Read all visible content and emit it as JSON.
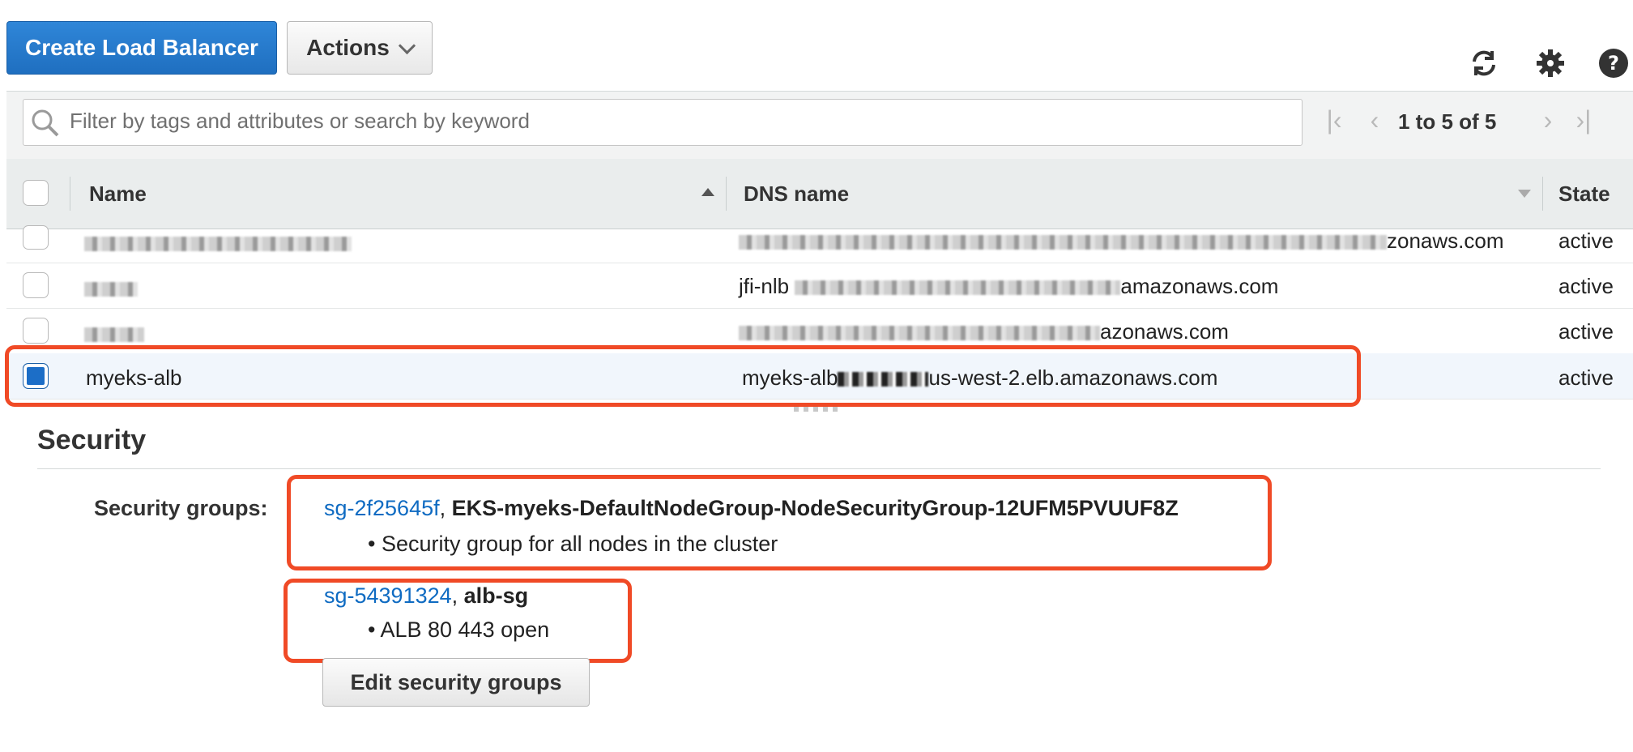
{
  "toolbar": {
    "create_label": "Create Load Balancer",
    "actions_label": "Actions",
    "icons": [
      "refresh-icon",
      "gear-icon",
      "help-icon"
    ]
  },
  "filter": {
    "placeholder": "Filter by tags and attributes or search by keyword",
    "pager": "1 to 5 of 5"
  },
  "table": {
    "columns": [
      "Name",
      "DNS name",
      "State"
    ],
    "rows": [
      {
        "name": "",
        "dns": "zonaws.com",
        "state": "active"
      },
      {
        "name": "",
        "dns": "jfi-nlb",
        "dns_suffix": "amazonaws.com",
        "state": "active"
      },
      {
        "name": "",
        "dns": "azonaws.com",
        "state": "active"
      },
      {
        "name": "myeks-alb",
        "dns": "myeks-alb",
        "dns_suffix": "us-west-2.elb.amazonaws.com",
        "state": "active",
        "selected": true
      }
    ]
  },
  "details": {
    "section_title": "Security",
    "label": "Security groups:",
    "groups": [
      {
        "id": "sg-2f25645f",
        "name": "EKS-myeks-DefaultNodeGroup-NodeSecurityGroup-12UFM5PVUUF8Z",
        "description": "Security group for all nodes in the cluster"
      },
      {
        "id": "sg-54391324",
        "name": "alb-sg",
        "description": "ALB 80 443 open"
      }
    ],
    "edit_label": "Edit security groups"
  },
  "colors": {
    "primary": "#1f6fc0",
    "link": "#0f6bc2",
    "highlight": "#f04a26",
    "selected_row": "#f1f6fc"
  }
}
